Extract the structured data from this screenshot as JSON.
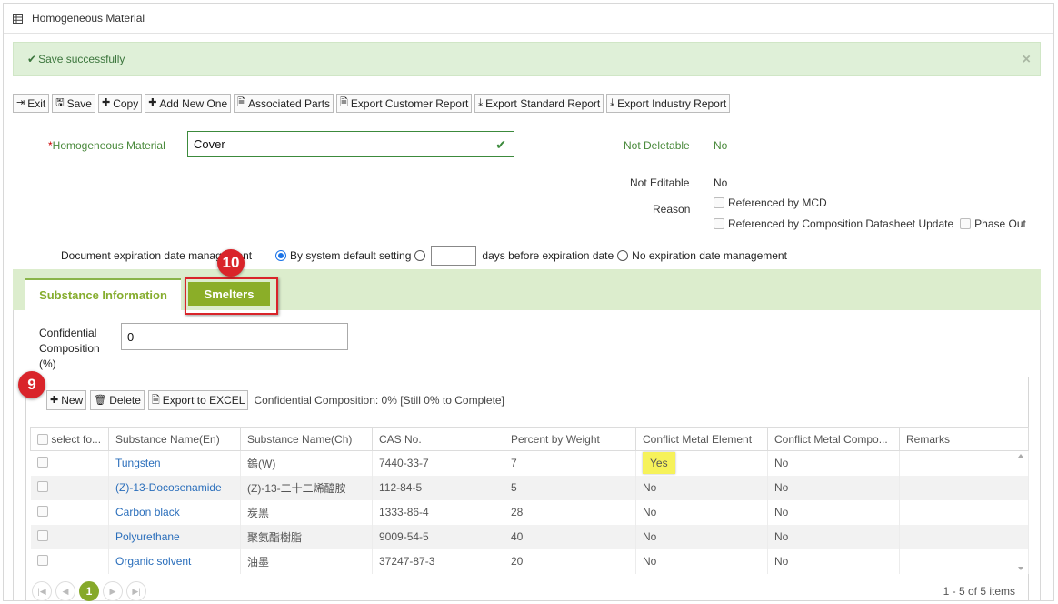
{
  "window": {
    "title": "Homogeneous Material"
  },
  "alert": {
    "message": "Save successfully",
    "close": "×"
  },
  "toolbar": {
    "exit": "Exit",
    "save": "Save",
    "copy": "Copy",
    "add_new": "Add New One",
    "associated_parts": "Associated Parts",
    "export_customer": "Export Customer Report",
    "export_standard": "Export Standard Report",
    "export_industry": "Export Industry Report"
  },
  "form": {
    "hm_label": "Homogeneous Material",
    "hm_required_mark": "*",
    "hm_value": "Cover",
    "not_deletable_label": "Not Deletable",
    "not_deletable_value": "No",
    "not_editable_label": "Not Editable",
    "not_editable_value": "No",
    "reason_label": "Reason",
    "reason_opt1": "Referenced by MCD",
    "reason_opt2": "Referenced by Composition Datasheet Update",
    "reason_opt3": "Phase Out",
    "doc_exp_label": "Document expiration date management",
    "opt_default": "By system default setting",
    "days_value": "",
    "opt_days_suffix": "days before expiration date",
    "opt_none": "No expiration date management"
  },
  "tabs": {
    "substance": "Substance Information",
    "smelters": "Smelters"
  },
  "annotations": {
    "badge_smelters": "10",
    "badge_grid": "9"
  },
  "confidential": {
    "label": "Confidential Composition (%)",
    "value": "0"
  },
  "grid": {
    "new": "New",
    "delete": "Delete",
    "export_excel": "Export to EXCEL",
    "status": "Confidential Composition: 0% [Still 0% to Complete]",
    "columns": [
      "select fo...",
      "Substance Name(En)",
      "Substance Name(Ch)",
      "CAS No.",
      "Percent by Weight",
      "Conflict Metal Element",
      "Conflict Metal Compo...",
      "Remarks"
    ],
    "rows": [
      {
        "en": "Tungsten",
        "ch": "鎢(W)",
        "cas": "7440-33-7",
        "pct": "7",
        "cme": "Yes",
        "cmc": "No",
        "remarks": ""
      },
      {
        "en": "(Z)-13-Docosenamide",
        "ch": "(Z)-13-二十二烯醯胺",
        "cas": "112-84-5",
        "pct": "5",
        "cme": "No",
        "cmc": "No",
        "remarks": ""
      },
      {
        "en": "Carbon black",
        "ch": "炭黑",
        "cas": "1333-86-4",
        "pct": "28",
        "cme": "No",
        "cmc": "No",
        "remarks": ""
      },
      {
        "en": "Polyurethane",
        "ch": "聚氨酯樹脂",
        "cas": "9009-54-5",
        "pct": "40",
        "cme": "No",
        "cmc": "No",
        "remarks": ""
      },
      {
        "en": "Organic solvent",
        "ch": "油墨",
        "cas": "37247-87-3",
        "pct": "20",
        "cme": "No",
        "cmc": "No",
        "remarks": ""
      }
    ],
    "pager": {
      "current": "1",
      "info": "1 - 5 of 5 items"
    }
  },
  "colors": {
    "accent": "#86ad2e",
    "tab_bar": "#dcedcd",
    "alert_bg": "#dff0d8",
    "badge": "#d9242a",
    "link": "#2a6ebb",
    "highlight": "#f6f25a"
  },
  "icons": [
    "grid-icon",
    "check-icon",
    "close-icon",
    "exit-icon",
    "save-icon",
    "plus-icon",
    "doc-icon",
    "excel-icon",
    "download-icon",
    "trash-icon"
  ]
}
